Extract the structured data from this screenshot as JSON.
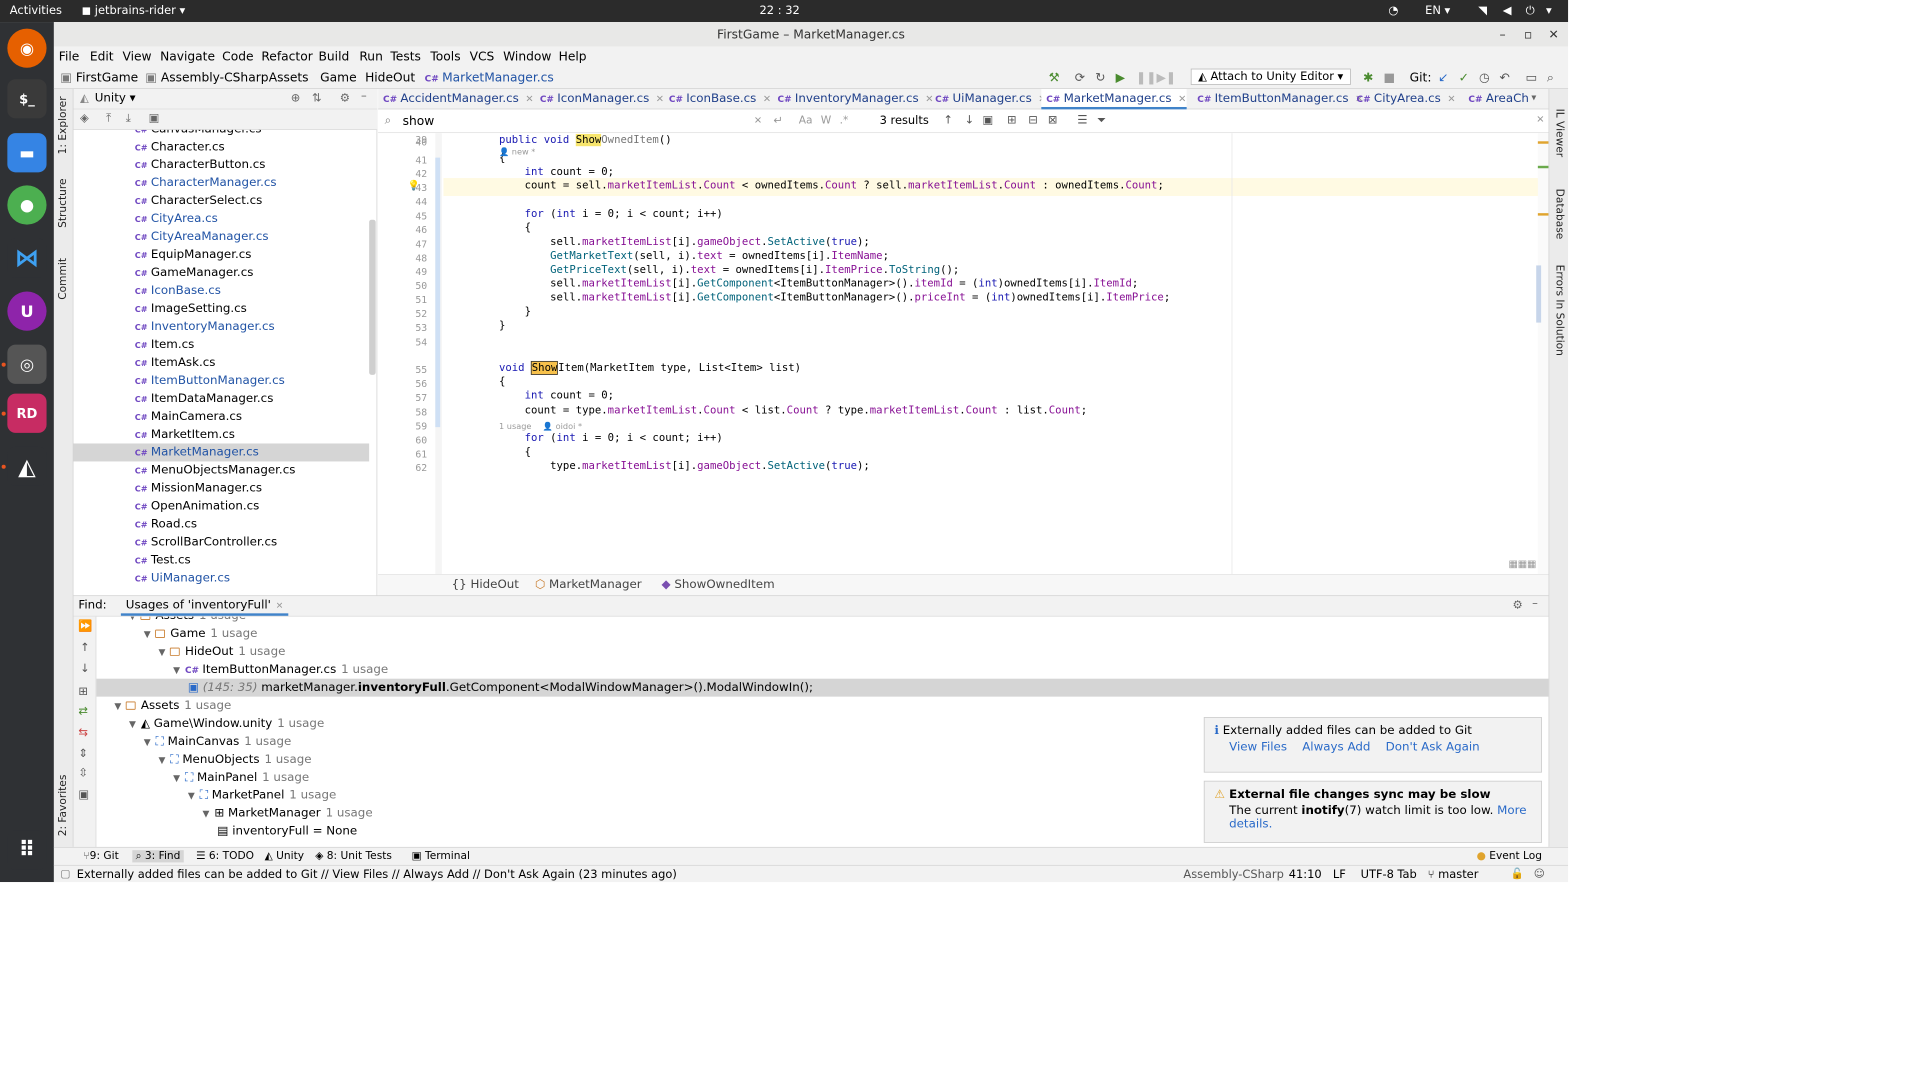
{
  "topbar": {
    "activities": "Activities",
    "app": "jetbrains-rider ▾",
    "clock": "22 : 32",
    "lang": "EN ▾"
  },
  "window": {
    "title": "FirstGame – MarketManager.cs"
  },
  "menu": [
    "File",
    "Edit",
    "View",
    "Navigate",
    "Code",
    "Refactor",
    "Build",
    "Run",
    "Tests",
    "Tools",
    "VCS",
    "Window",
    "Help"
  ],
  "breadcrumb": [
    "FirstGame",
    "Assembly-CSharp",
    "Assets",
    "Game",
    "HideOut",
    "MarketManager.cs"
  ],
  "run_config": "Attach to Unity Editor",
  "git_label": "Git:",
  "left_strip": [
    "1: Explorer",
    "Structure",
    "Commit",
    "2: Favorites"
  ],
  "right_strip": [
    "IL Viewer",
    "Database",
    "Errors In Solution"
  ],
  "explorer": {
    "title": "Unity ▾",
    "files": [
      {
        "name": "CanvasManager.cs",
        "vcs": false
      },
      {
        "name": "Character.cs",
        "vcs": false
      },
      {
        "name": "CharacterButton.cs",
        "vcs": false
      },
      {
        "name": "CharacterManager.cs",
        "vcs": true
      },
      {
        "name": "CharacterSelect.cs",
        "vcs": false
      },
      {
        "name": "CityArea.cs",
        "vcs": true
      },
      {
        "name": "CityAreaManager.cs",
        "vcs": true
      },
      {
        "name": "EquipManager.cs",
        "vcs": false
      },
      {
        "name": "GameManager.cs",
        "vcs": false
      },
      {
        "name": "IconBase.cs",
        "vcs": true
      },
      {
        "name": "ImageSetting.cs",
        "vcs": false
      },
      {
        "name": "InventoryManager.cs",
        "vcs": true
      },
      {
        "name": "Item.cs",
        "vcs": false
      },
      {
        "name": "ItemAsk.cs",
        "vcs": false
      },
      {
        "name": "ItemButtonManager.cs",
        "vcs": true
      },
      {
        "name": "ItemDataManager.cs",
        "vcs": false
      },
      {
        "name": "MainCamera.cs",
        "vcs": false
      },
      {
        "name": "MarketItem.cs",
        "vcs": false
      },
      {
        "name": "MarketManager.cs",
        "vcs": true,
        "selected": true
      },
      {
        "name": "MenuObjectsManager.cs",
        "vcs": false
      },
      {
        "name": "MissionManager.cs",
        "vcs": false
      },
      {
        "name": "OpenAnimation.cs",
        "vcs": false
      },
      {
        "name": "Road.cs",
        "vcs": false
      },
      {
        "name": "ScrollBarController.cs",
        "vcs": false
      },
      {
        "name": "Test.cs",
        "vcs": false
      },
      {
        "name": "UiManager.cs",
        "vcs": true
      }
    ]
  },
  "tabs": [
    "AccidentManager.cs",
    "IconManager.cs",
    "IconBase.cs",
    "InventoryManager.cs",
    "UiManager.cs",
    "MarketManager.cs",
    "ItemButtonManager.cs",
    "CityArea.cs",
    "AreaCh"
  ],
  "cs_prefix": "C#",
  "search": {
    "value": "show",
    "results": "3 results",
    "aa": "Aa",
    "w": "W"
  },
  "editor_hints": {
    "new": "new *",
    "usage": "1 usage",
    "author": "oidoi *"
  },
  "code_lines": [
    {
      "n": "39",
      "t": ""
    },
    {
      "n": "40",
      "t": "public void ShowOwnedItem()"
    },
    {
      "n": "41",
      "t": "{"
    },
    {
      "n": "42",
      "t": "    int count = 0;"
    },
    {
      "n": "43",
      "t": "    count = sell.marketItemList.Count < ownedItems.Count ? sell.marketItemList.Count : ownedItems.Count;"
    },
    {
      "n": "44",
      "t": ""
    },
    {
      "n": "45",
      "t": "    for (int i = 0; i < count; i++)"
    },
    {
      "n": "46",
      "t": "    {"
    },
    {
      "n": "47",
      "t": "        sell.marketItemList[i].gameObject.SetActive(true);"
    },
    {
      "n": "48",
      "t": "        GetMarketText(sell, i).text = ownedItems[i].ItemName;"
    },
    {
      "n": "49",
      "t": "        GetPriceText(sell, i).text = ownedItems[i].ItemPrice.ToString();"
    },
    {
      "n": "50",
      "t": "        sell.marketItemList[i].GetComponent<ItemButtonManager>().itemId = (int)ownedItems[i].ItemId;"
    },
    {
      "n": "51",
      "t": "        sell.marketItemList[i].GetComponent<ItemButtonManager>().priceInt = (int)ownedItems[i].ItemPrice;"
    },
    {
      "n": "52",
      "t": "    }"
    },
    {
      "n": "53",
      "t": "}"
    },
    {
      "n": "54",
      "t": ""
    },
    {
      "n": "55",
      "t": "void ShowItem(MarketItem type, List<Item> list)"
    },
    {
      "n": "56",
      "t": "{"
    },
    {
      "n": "57",
      "t": "    int count = 0;"
    },
    {
      "n": "58",
      "t": "    count = type.marketItemList.Count < list.Count ? type.marketItemList.Count : list.Count;"
    },
    {
      "n": "59",
      "t": ""
    },
    {
      "n": "60",
      "t": "    for (int i = 0; i < count; i++)"
    },
    {
      "n": "61",
      "t": "    {"
    },
    {
      "n": "62",
      "t": "        type.marketItemList[i].gameObject.SetActive(true);"
    }
  ],
  "editor_breadcrumb": [
    "HideOut",
    "MarketManager",
    "ShowOwnedItem"
  ],
  "find": {
    "label": "Find:",
    "tab": "Usages of 'inventoryFull'",
    "rows": [
      {
        "text": "Assets",
        "count": "1 usage",
        "kind": "folder"
      },
      {
        "text": "Game",
        "count": "1 usage",
        "kind": "folder"
      },
      {
        "text": "HideOut",
        "count": "1 usage",
        "kind": "folder"
      },
      {
        "text": "ItemButtonManager.cs",
        "count": "1 usage",
        "kind": "cs"
      },
      {
        "loc": "(145: 35)",
        "pre": "marketManager.",
        "bold": "inventoryFull",
        "post": ".GetComponent<ModalWindowManager>().ModalWindowIn();",
        "kind": "usage"
      },
      {
        "text": "Assets",
        "count": "1 usage",
        "kind": "folder"
      },
      {
        "text": "Game\\Window.unity",
        "count": "1 usage",
        "kind": "unity"
      },
      {
        "text": "MainCanvas",
        "count": "1 usage",
        "kind": "go"
      },
      {
        "text": "MenuObjects",
        "count": "1 usage",
        "kind": "go"
      },
      {
        "text": "MainPanel",
        "count": "1 usage",
        "kind": "go"
      },
      {
        "text": "MarketPanel",
        "count": "1 usage",
        "kind": "go"
      },
      {
        "text": "MarketManager",
        "count": "1 usage",
        "kind": "comp"
      },
      {
        "text": "inventoryFull = None",
        "count": "",
        "kind": "field"
      }
    ]
  },
  "notifications": [
    {
      "title": "Externally added files can be added to Git",
      "links": [
        "View Files",
        "Always Add",
        "Don't Ask Again"
      ]
    },
    {
      "title": "External file changes sync may be slow",
      "body_pre": "The current ",
      "body_bold": "inotify",
      "body_post": "(7) watch limit is too low. ",
      "link": "More details."
    }
  ],
  "bottom_tools": [
    "9: Git",
    "3: Find",
    "6: TODO",
    "Unity",
    "8: Unit Tests",
    "Terminal"
  ],
  "event_log": "Event Log",
  "status": {
    "message": "Externally added files can be added to Git // View Files // Always Add // Don't Ask Again (23 minutes ago)",
    "project": "Assembly-CSharp",
    "pos": "41:10",
    "eol": "LF",
    "enc": "UTF-8",
    "indent": "Tab",
    "branch": "master"
  }
}
